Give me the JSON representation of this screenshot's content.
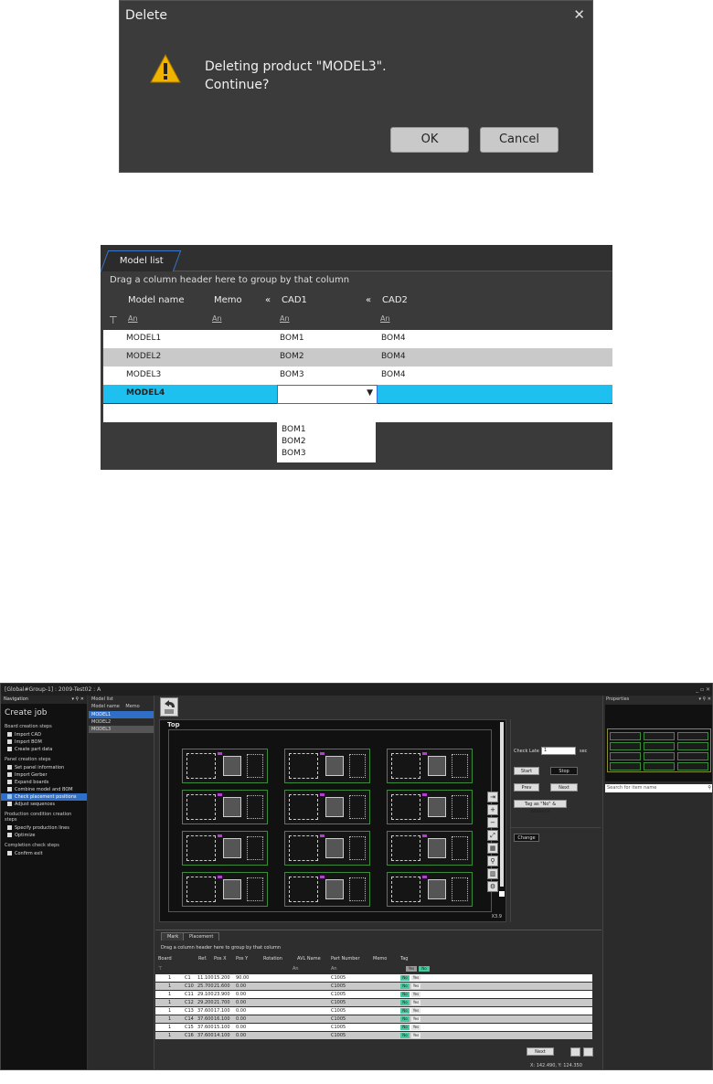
{
  "dialog": {
    "title": "Delete",
    "close": "✕",
    "message_line1": "Deleting product \"MODEL3\".",
    "message_line2": "Continue?",
    "ok": "OK",
    "cancel": "Cancel",
    "warn_color": "#f0b400"
  },
  "modellist": {
    "tab": "Model list",
    "hint": "Drag a column header here to group by that column",
    "columns": [
      "Model name",
      "Memo",
      "CAD1",
      "CAD2"
    ],
    "group_marker": "«",
    "filter_token": "An",
    "rows": [
      {
        "name": "MODEL1",
        "cad1": "BOM1",
        "cad2": "BOM4"
      },
      {
        "name": "MODEL2",
        "cad1": "BOM2",
        "cad2": "BOM4"
      },
      {
        "name": "MODEL3",
        "cad1": "BOM3",
        "cad2": "BOM4"
      },
      {
        "name": "MODEL4",
        "cad1": "",
        "cad2": ""
      }
    ],
    "dropdown": [
      "BOM1",
      "BOM2",
      "BOM3"
    ],
    "selected_color": "#1ec0f0"
  },
  "app": {
    "title": "[Global#Group-1] : 2009-Test02 : A",
    "window_controls": "_ ▫ ✕",
    "navigation": {
      "title": "Navigation",
      "controls": "▾ ⚲ ✕",
      "heading": "Create job",
      "sections": [
        {
          "label": "Board creation steps",
          "items": [
            "Import CAD",
            "Import BOM",
            "Create part data"
          ]
        },
        {
          "label": "Panel creation steps",
          "items": [
            "Set panel information",
            "Import Gerber",
            "Expand boards",
            "Combine model and BOM",
            "Check placement positions",
            "Adjust sequences"
          ]
        },
        {
          "label": "Production condition creation steps",
          "items": [
            "Specify production lines",
            "Optimize"
          ]
        },
        {
          "label": "Completion check steps",
          "items": [
            "Confirm exit"
          ]
        }
      ]
    },
    "model_panel": {
      "title": "Model list",
      "col1": "Model name",
      "col2": "Memo",
      "items": [
        "MODEL1",
        "MODEL2",
        "MODEL3"
      ]
    },
    "view": {
      "label": "Top",
      "zoom": "X3.9"
    },
    "checks": {
      "check_late_label": "Check Late",
      "check_late_value": "1",
      "unit": "sec",
      "start": "Start",
      "stop": "Stop",
      "prev": "Prev",
      "next": "Next",
      "tag_advance": "Tag as \"No\" & advance",
      "change": "Change"
    },
    "grid": {
      "tabs": [
        "Mark",
        "Placement"
      ],
      "hint": "Drag a column header here to group by that column",
      "columns": [
        "Board",
        "Ref.",
        "Pos X",
        "Pos Y",
        "Rotation",
        "AVL Name",
        "Part Number",
        "Memo",
        "Tag"
      ],
      "filter_token": "An",
      "tag_no": "No",
      "tag_yes": "Yes",
      "rows": [
        {
          "board": "1",
          "ref": "C1",
          "x": "11.100",
          "y": "15.200",
          "rot": "90.00",
          "pn": "C1005"
        },
        {
          "board": "1",
          "ref": "C10",
          "x": "25.700",
          "y": "21.600",
          "rot": "0.00",
          "pn": "C1005"
        },
        {
          "board": "1",
          "ref": "C11",
          "x": "29.100",
          "y": "23.900",
          "rot": "0.00",
          "pn": "C1005"
        },
        {
          "board": "1",
          "ref": "C12",
          "x": "29.200",
          "y": "21.700",
          "rot": "0.00",
          "pn": "C1005"
        },
        {
          "board": "1",
          "ref": "C13",
          "x": "37.600",
          "y": "17.100",
          "rot": "0.00",
          "pn": "C1005"
        },
        {
          "board": "1",
          "ref": "C14",
          "x": "37.600",
          "y": "16.100",
          "rot": "0.00",
          "pn": "C1005"
        },
        {
          "board": "1",
          "ref": "C15",
          "x": "37.600",
          "y": "15.100",
          "rot": "0.00",
          "pn": "C1005"
        },
        {
          "board": "1",
          "ref": "C16",
          "x": "37.600",
          "y": "14.100",
          "rot": "0.00",
          "pn": "C1005"
        }
      ],
      "next": "Next",
      "coords": "X: 142.490, Y: 124.350"
    },
    "properties": {
      "title": "Properties",
      "controls": "▾ ⚲ ✕",
      "search_placeholder": "Search for item name"
    },
    "accent": "#2f6fc8"
  }
}
